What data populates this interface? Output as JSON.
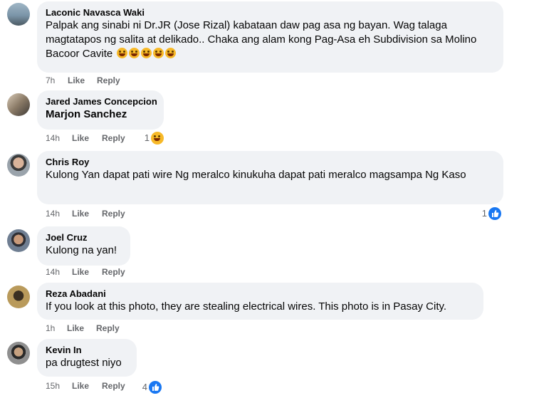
{
  "ui": {
    "like_label": "Like",
    "reply_label": "Reply"
  },
  "comments": [
    {
      "author": "Laconic Navasca Waki",
      "text": "Palpak ang sinabi ni Dr.JR (Jose Rizal) kabataan daw pag asa ng bayan. Wag talaga magtatapos ng salita at delikado.. Chaka ang alam kong Pag-Asa eh Subdivision sa Molino Bacoor Cavite",
      "emoji": "rolling-on-floor-laughing x5",
      "time": "7h"
    },
    {
      "author": "Jared James Concepcion",
      "text": "Marjon Sanchez",
      "time": "14h",
      "reaction_count": "1",
      "reaction_icon": "haha-icon"
    },
    {
      "author": "Chris Roy",
      "text": "Kulong Yan dapat pati wire Ng meralco kinukuha dapat pati meralco magsampa Ng Kaso",
      "time": "14h",
      "reaction_count": "1",
      "reaction_icon": "like-icon"
    },
    {
      "author": "Joel Cruz",
      "text": "Kulong na yan!",
      "time": "14h"
    },
    {
      "author": "Reza Abadani",
      "text": "If you look at this photo, they are stealing electrical wires. This photo is in Pasay City.",
      "time": "1h"
    },
    {
      "author": "Kevin In",
      "text": "pa drugtest niyo",
      "time": "15h",
      "reaction_count": "4",
      "reaction_icon": "like-icon"
    }
  ]
}
